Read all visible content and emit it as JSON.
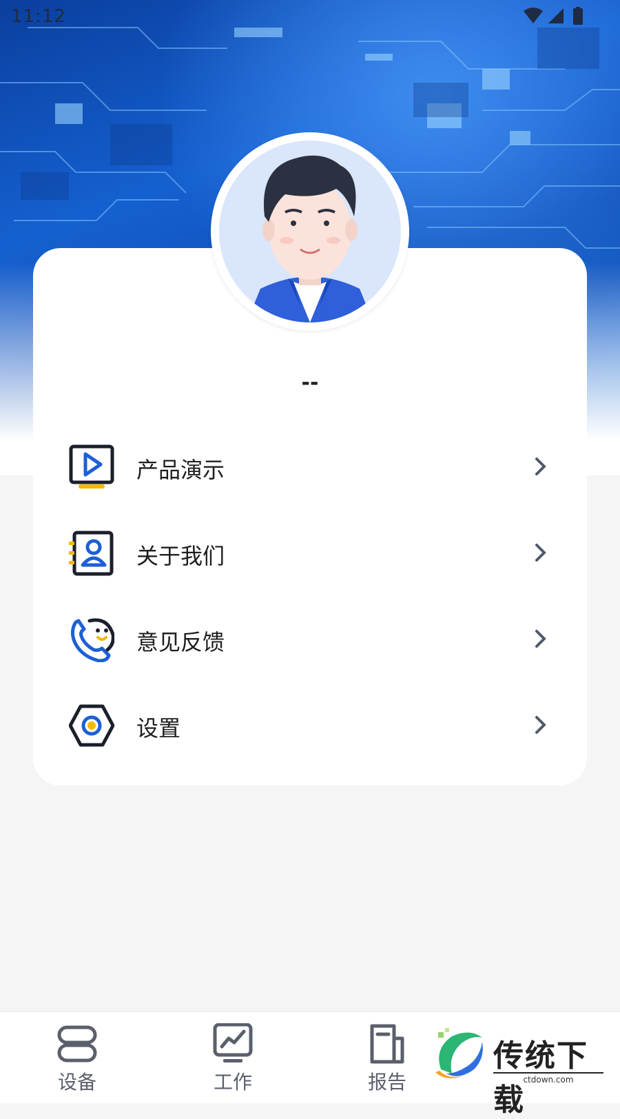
{
  "status_bar": {
    "time": "11:12"
  },
  "profile": {
    "name": "--"
  },
  "menu": [
    {
      "label": "产品演示",
      "icon": "play-screen-icon"
    },
    {
      "label": "关于我们",
      "icon": "contact-card-icon"
    },
    {
      "label": "意见反馈",
      "icon": "phone-feedback-icon"
    },
    {
      "label": "设置",
      "icon": "hex-settings-icon"
    }
  ],
  "tabbar": [
    {
      "label": "设备",
      "icon": "device-icon"
    },
    {
      "label": "工作",
      "icon": "chart-monitor-icon"
    },
    {
      "label": "报告",
      "icon": "document-icon"
    }
  ],
  "watermark": {
    "title": "传统下载",
    "url": "ctdown.com"
  },
  "colors": {
    "accent_blue": "#1e5fd6",
    "accent_yellow": "#f5b800",
    "text": "#1e1e1e"
  }
}
